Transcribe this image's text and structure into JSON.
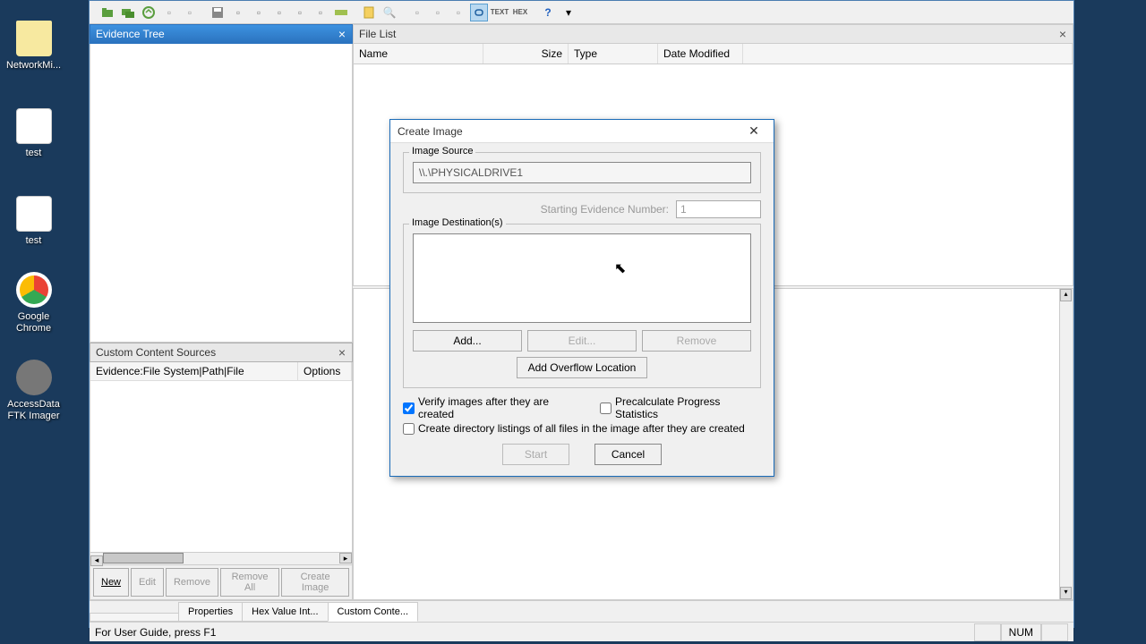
{
  "desktop": {
    "icons": [
      {
        "label": "NetworkMi...",
        "type": "folder"
      },
      {
        "label": "test",
        "type": "txt"
      },
      {
        "label": "test",
        "type": "txt"
      },
      {
        "label": "Google\nChrome",
        "type": "chrome"
      },
      {
        "label": "AccessData\nFTK Imager",
        "type": "ftk"
      }
    ]
  },
  "panes": {
    "evidence_tree": "Evidence Tree",
    "file_list": "File List",
    "custom_content": "Custom Content Sources"
  },
  "file_list_cols": {
    "name": "Name",
    "size": "Size",
    "type": "Type",
    "date": "Date Modified"
  },
  "ccs_cols": {
    "path": "Evidence:File System|Path|File",
    "options": "Options"
  },
  "ccs_buttons": {
    "new": "New",
    "edit": "Edit",
    "remove": "Remove",
    "remove_all": "Remove All",
    "create_image": "Create Image"
  },
  "bottom_tabs": {
    "properties": "Properties",
    "hex": "Hex Value Int...",
    "custom": "Custom Conte..."
  },
  "statusbar": {
    "hint": "For User Guide, press F1",
    "num": "NUM"
  },
  "dialog": {
    "title": "Create Image",
    "image_source_legend": "Image Source",
    "image_source_value": "\\\\.\\PHYSICALDRIVE1",
    "starting_ev_label": "Starting Evidence Number:",
    "starting_ev_value": "1",
    "image_dest_legend": "Image Destination(s)",
    "add": "Add...",
    "edit": "Edit...",
    "remove": "Remove",
    "overflow": "Add Overflow Location",
    "verify": "Verify images after they are created",
    "precalc": "Precalculate Progress Statistics",
    "dirlist": "Create directory listings of all files in the image after they are created",
    "start": "Start",
    "cancel": "Cancel"
  }
}
